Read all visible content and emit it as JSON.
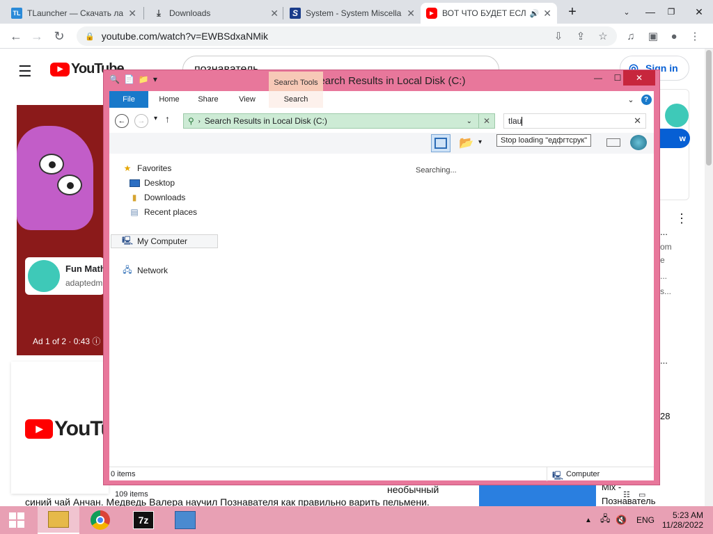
{
  "browser": {
    "tabs": [
      {
        "title": "TLauncher — Скачать ла",
        "favicon": "TL",
        "favicon_color": "#2a8ad8"
      },
      {
        "title": "Downloads",
        "favicon": "download-icon"
      },
      {
        "title": "System - System Miscella",
        "favicon": "S",
        "favicon_color": "#1a3c8a"
      },
      {
        "title": "ВОТ ЧТО БУДЕТ ЕСЛ",
        "favicon": "youtube-icon",
        "favicon_color": "#ff0000",
        "active": true
      }
    ],
    "new_tab": "+",
    "url": "youtube.com/watch?v=EWBSdxaNMik"
  },
  "youtube": {
    "logo_text": "YouTube",
    "search_query": "познаватель",
    "signin": "Sign in",
    "ad_card_title": "Fun Math",
    "ad_card_sub": "adaptedm",
    "ad_label": "Ad 1 of 2 · 0:43",
    "desc_line": "синий чай Анчан. Медведь Валера научил Познавателя как правильно варить пельмени.",
    "desc_right": "необычный",
    "side_title_1": "Mix -",
    "side_title_2": "Познаватель",
    "side_w": "w",
    "side_num": "28",
    "side_frag_1": "...",
    "side_frag_2": "om",
    "side_frag_3": "e",
    "side_frag_4": "...",
    "side_frag_5": "s...",
    "side_frag_6": "..."
  },
  "explorer": {
    "title": "tl - Search Results in Local Disk (C:)",
    "context_tab": "Search Tools",
    "ribbon_tabs": [
      "File",
      "Home",
      "Share",
      "View",
      "Search"
    ],
    "address": "Search Results in Local Disk (C:)",
    "search_text": "tlau",
    "tooltip": "Stop loading \"едфгтсрук\"",
    "nav": {
      "favorites": "Favorites",
      "desktop": "Desktop",
      "downloads": "Downloads",
      "recent": "Recent places",
      "computer": "My Computer",
      "network": "Network"
    },
    "status_text": "Searching...",
    "items_count": "109 items",
    "selected_count": "0 items",
    "status_location": "Computer"
  },
  "taskbar": {
    "lang": "ENG",
    "time": "5:23 AM",
    "date": "11/28/2022"
  },
  "colors": {
    "explorer_frame": "#e8779b",
    "taskbar": "#e8a0b4",
    "file_tab": "#1979ca",
    "address_bg": "#cdebd5",
    "context_tab": "#f7c9b7"
  }
}
